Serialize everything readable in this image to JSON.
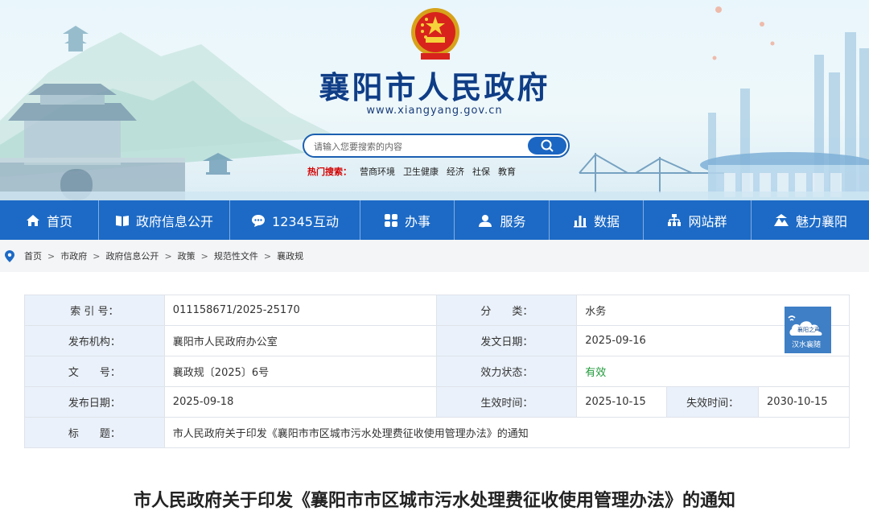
{
  "header": {
    "site_title": "襄阳市人民政府",
    "site_url": "www.xiangyang.gov.cn",
    "search_placeholder": "请输入您要搜索的内容",
    "hot_label": "热门搜索：",
    "hot_links": [
      "营商环境",
      "卫生健康",
      "经济",
      "社保",
      "教育"
    ]
  },
  "nav": {
    "items": [
      {
        "label": "首页",
        "icon": "home-icon"
      },
      {
        "label": "政府信息公开",
        "icon": "book-icon"
      },
      {
        "label": "12345互动",
        "icon": "chat-icon"
      },
      {
        "label": "办事",
        "icon": "grid-icon"
      },
      {
        "label": "服务",
        "icon": "person-icon"
      },
      {
        "label": "数据",
        "icon": "bar-chart-icon"
      },
      {
        "label": "网站群",
        "icon": "sitemap-icon"
      },
      {
        "label": "魅力襄阳",
        "icon": "scenery-icon"
      }
    ]
  },
  "breadcrumb": [
    "首页",
    "市政府",
    "政府信息公开",
    "政策",
    "规范性文件",
    "襄政规"
  ],
  "meta": {
    "index_label": "索 引 号：",
    "index_value": "011158671/2025-25170",
    "category_label": "分　　类：",
    "category_value": "水务",
    "issuer_label": "发布机构：",
    "issuer_value": "襄阳市人民政府办公室",
    "date_issued_label": "发文日期：",
    "date_issued_value": "2025-09-16",
    "doc_no_label": "文　　号：",
    "doc_no_value": "襄政规〔2025〕6号",
    "status_label": "效力状态：",
    "status_value": "有效",
    "publish_label": "发布日期：",
    "publish_value": "2025-09-18",
    "effective_label": "生效时间：",
    "effective_value": "2025-10-15",
    "expire_label": "失效时间：",
    "expire_value": "2030-10-15",
    "title_label": "标　　题：",
    "title_value": "市人民政府关于印发《襄阳市市区城市污水处理费征收使用管理办法》的通知"
  },
  "badge": {
    "line1": "襄阳之声",
    "line2": "汉水襄随"
  },
  "doc_title": "市人民政府关于印发《襄阳市市区城市污水处理费征收使用管理办法》的通知",
  "colors": {
    "nav": "#1c6ac6",
    "title": "#0f3d86",
    "valid": "#1f9a3a",
    "hot": "#d40000"
  }
}
